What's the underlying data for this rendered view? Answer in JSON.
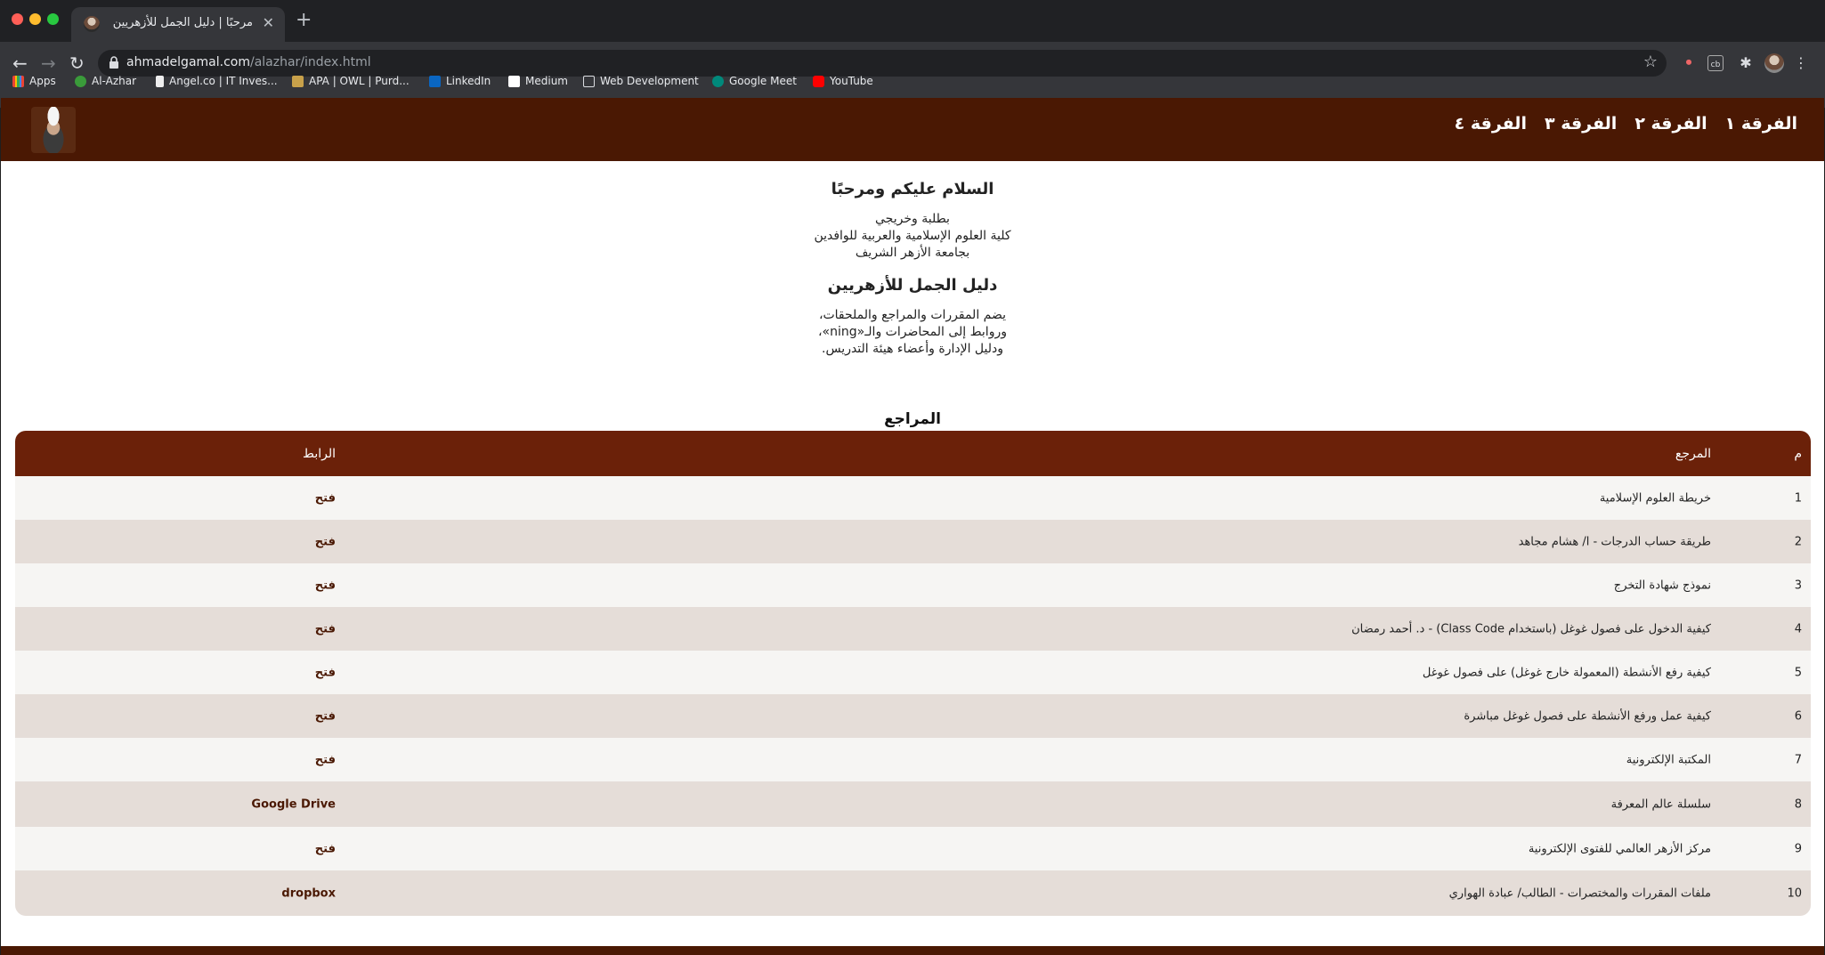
{
  "browser": {
    "tab_title": "مرحبًا | دليل الجمل للأزهريين",
    "url_host": "ahmadelgamal.com",
    "url_path": "/alazhar/index.html",
    "bookmarks": [
      "Apps",
      "Al-Azhar",
      "Angel.co | IT Inves...",
      "APA | OWL | Purd...",
      "LinkedIn",
      "Medium",
      "Web Development",
      "Google Meet",
      "YouTube"
    ]
  },
  "site": {
    "nav": [
      "الفرقة ١",
      "الفرقة ٢",
      "الفرقة ٣",
      "الفرقة ٤"
    ]
  },
  "intro": {
    "greeting": "السلام عليكم ومرحبًا",
    "lines1": [
      "بطلبة وخريجي",
      "كلية العلوم الإسلامية والعربية للوافدين",
      "بجامعة الأزهر الشريف"
    ],
    "guide_title": "دليل الجمل للأزهريين",
    "lines2": [
      "يضم المقررات والمراجع والملحقات،",
      "وروابط إلى المحاضرات والـ«ning»،",
      "ودليل الإدارة وأعضاء هيئة التدريس."
    ]
  },
  "references": {
    "title": "المراجع",
    "headers": {
      "num": "م",
      "ref": "المرجع",
      "link": "الرابط"
    },
    "rows": [
      {
        "num": "1",
        "ref": "خريطة العلوم الإسلامية",
        "link": "فتح"
      },
      {
        "num": "2",
        "ref": "طريقة حساب الدرجات - ا/ هشام مجاهد",
        "link": "فتح"
      },
      {
        "num": "3",
        "ref": "نموذج شهادة التخرج",
        "link": "فتح"
      },
      {
        "num": "4",
        "ref": "كيفية الدخول على فصول غوغل (باستخدام Class Code) - د. أحمد رمضان",
        "link": "فتح"
      },
      {
        "num": "5",
        "ref": "كيفية رفع الأنشطة (المعمولة خارج غوغل) على فصول غوغل",
        "link": "فتح"
      },
      {
        "num": "6",
        "ref": "كيفية عمل ورفع الأنشطة على فصول غوغل مباشرة",
        "link": "فتح"
      },
      {
        "num": "7",
        "ref": "المكتبة الإلكترونية",
        "link": "فتح"
      },
      {
        "num": "8",
        "ref": "سلسلة عالم المعرفة",
        "link": "Google Drive"
      },
      {
        "num": "9",
        "ref": "مركز الأزهر العالمي للفتوى الإلكترونية",
        "link": "فتح"
      },
      {
        "num": "10",
        "ref": "ملفات المقررات والمختصرات - الطالب/ عبادة الهواري",
        "link": "dropbox"
      }
    ]
  },
  "colors": {
    "header_bg": "#4a1803",
    "table_head_bg": "#6b2109",
    "row_odd": "#f6f5f3",
    "row_even": "#e5ddd8"
  }
}
